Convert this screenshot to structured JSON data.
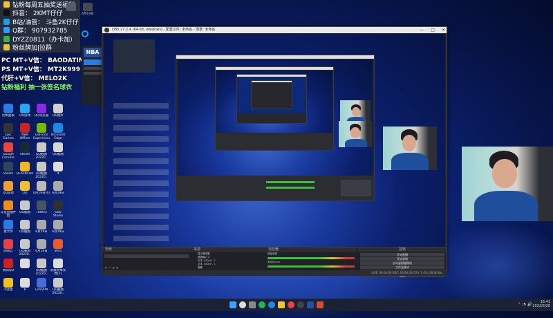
{
  "overlay": {
    "lines": [
      {
        "text": "钻粉每周五抽奖送福利",
        "color": "#f2c230"
      },
      {
        "text": "抖音： 2KMT仔仔",
        "color": "#111111"
      },
      {
        "text": "B站/油管： 斗鱼2K仔仔",
        "color": "#1aa0e6"
      },
      {
        "text": "Q群： 907932785",
        "color": "#2d9cf0"
      },
      {
        "text": "DYZZ0811（办卡加）",
        "color": "#3ab44a"
      },
      {
        "text": "粉丝牌加|拉群",
        "color": "#e6c23a"
      }
    ]
  },
  "promo": {
    "line1": "PC MT+V信： BAODATING2K",
    "line2": "PS MT+V信： MT2K999",
    "line3": "代肝+V信： MELO2K",
    "line4": "钻粉福利 抽一张签名球衣"
  },
  "top_thumbs": [
    {
      "label": "",
      "color": "#555a66"
    },
    {
      "label": "6月19日",
      "color": "#444a55"
    }
  ],
  "desktop_icons": [
    {
      "label": "控制面板",
      "color": "#2c7be5"
    },
    {
      "label": "QQ游戏",
      "color": "#2aa4f4"
    },
    {
      "label": "QQ浏览器",
      "color": "#8a2be2"
    },
    {
      "label": "QQ图片",
      "color": "#d0d0d0"
    },
    {
      "label": "Epic Games Launcher",
      "color": "#333333"
    },
    {
      "label": "NBA Offline",
      "color": "#cc2222"
    },
    {
      "label": "GeForce Experience",
      "color": "#76b900"
    },
    {
      "label": "Microsoft Edge",
      "color": "#1e88e5"
    },
    {
      "label": "Google Chrome",
      "color": "#e8453c"
    },
    {
      "label": "Steam",
      "color": "#1b2838"
    },
    {
      "label": "QQ截图20220..",
      "color": "#c9c9c9"
    },
    {
      "label": "QQ截图",
      "color": "#d6d6d6"
    },
    {
      "label": "Steam",
      "color": "#2a475e"
    },
    {
      "label": "BLACKCORE",
      "color": "#f3b81a"
    },
    {
      "label": "QQ截图20220..",
      "color": "#c9c9c9"
    },
    {
      "label": "4",
      "color": "#dddddd"
    },
    {
      "label": "QQ游戏",
      "color": "#f0a030"
    },
    {
      "label": "QQ",
      "color": "#f0c030"
    },
    {
      "label": "6月19日(6)",
      "color": "#bbbbbb"
    },
    {
      "label": "6月19日",
      "color": "#aaaaaa"
    },
    {
      "label": "斗鱼直播伴侣",
      "color": "#f08c1a"
    },
    {
      "label": "QQ截图",
      "color": "#c9c9c9"
    },
    {
      "label": "TRBtns",
      "color": "#445566"
    },
    {
      "label": "OBS Studio",
      "color": "#303030"
    },
    {
      "label": "鲁大师",
      "color": "#2c7be5"
    },
    {
      "label": "QQ截图",
      "color": "#c9c9c9"
    },
    {
      "label": "6月19日",
      "color": "#aaaaaa"
    },
    {
      "label": "6月19日",
      "color": "#aaaaaa"
    },
    {
      "label": "网易云",
      "color": "#e6404b"
    },
    {
      "label": "QQ截图20220..",
      "color": "#c9c9c9"
    },
    {
      "label": "6月19日",
      "color": "#aaaaaa"
    },
    {
      "label": "WPS",
      "color": "#e85c2f"
    },
    {
      "label": "腾讯QQ",
      "color": "#cc2222"
    },
    {
      "label": "",
      "color": "#dddddd"
    },
    {
      "label": "QQ截图20220..",
      "color": "#c9c9c9"
    },
    {
      "label": "新建文本文档(7)",
      "color": "#dddddd"
    },
    {
      "label": "小黑盒",
      "color": "#f0c020"
    },
    {
      "label": "6",
      "color": "#dddddd"
    },
    {
      "label": "LetsVPN",
      "color": "#4b6bd6"
    },
    {
      "label": "QQ截图20220..",
      "color": "#c9c9c9"
    }
  ],
  "obs": {
    "title": "OBS 27.2.4 (64-bit, windows) - 配置文件: 未命名 - 场景: 未命名",
    "min": "—",
    "max": "□",
    "close": "✕",
    "docks": {
      "scenes": "场景",
      "sources": "来源",
      "mixer": "混音器",
      "transitions": "转场",
      "controls": "控制"
    },
    "sources_list": [
      "显示器采集",
      "音频输入 2",
      "文本（GDI+）2",
      "文本（GDI+）1",
      "图像"
    ],
    "mixer_labels": [
      "桌面音频",
      "麦克风/Aux"
    ],
    "controls_buttons": [
      "开始直播",
      "开始录制",
      "启动虚拟摄像机",
      "工作室模式",
      "设置",
      "退出"
    ],
    "status": "LIVE: 00:00:00   REC: 00:00:00   CPU: 1.0%, 60.00 fps"
  },
  "tray": {
    "time": "16:41",
    "date": "2022/6/20"
  },
  "colors": {
    "accent": "#2c7be5"
  }
}
